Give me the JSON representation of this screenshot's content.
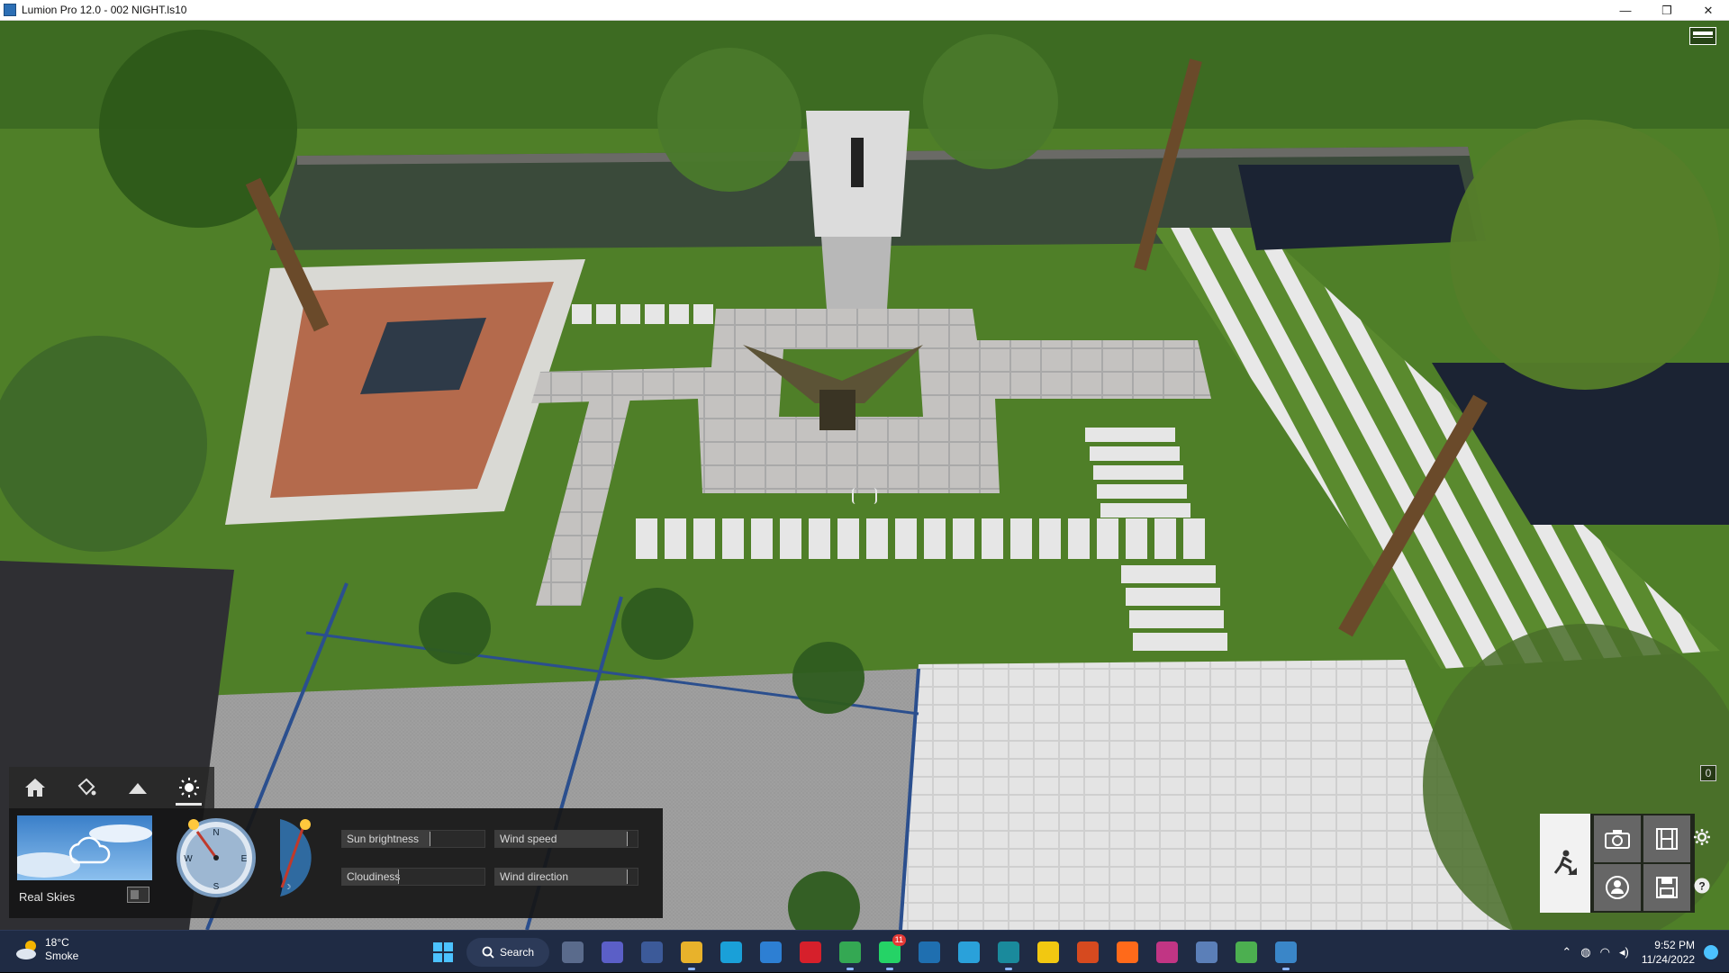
{
  "window": {
    "title": "Lumion Pro 12.0  - 002 NIGHT.ls10",
    "minimize_glyph": "—",
    "maximize_glyph": "❐",
    "close_glyph": "✕"
  },
  "viewport": {
    "corner_marker": "0"
  },
  "weather_panel": {
    "tabs": [
      {
        "icon": "house-icon",
        "active": false
      },
      {
        "icon": "paint-bucket-icon",
        "active": false
      },
      {
        "icon": "landscape-icon",
        "active": false
      },
      {
        "icon": "sun-icon",
        "active": true
      }
    ],
    "real_skies_label": "Real Skies",
    "real_skies_enabled": false,
    "compass": {
      "n": "N",
      "e": "E",
      "s": "S",
      "w": "W"
    },
    "sliders": {
      "sun_brightness": {
        "label": "Sun brightness",
        "value": 0.62
      },
      "wind_speed": {
        "label": "Wind speed",
        "value": 0.93
      },
      "cloudiness": {
        "label": "Cloudiness",
        "value": 0.4
      },
      "wind_direction": {
        "label": "Wind direction",
        "value": 0.93
      }
    }
  },
  "tool_panel": {
    "tools": [
      "build-mode-icon",
      "camera-icon",
      "film-icon",
      "panorama-icon",
      "save-icon"
    ],
    "side_icons": [
      "settings-icon",
      "help-icon"
    ]
  },
  "taskbar": {
    "weather": {
      "temp": "18°C",
      "condition": "Smoke"
    },
    "search_label": "Search",
    "whatsapp_badge": "11",
    "clock": {
      "time": "9:52 PM",
      "date": "11/24/2022"
    },
    "apps": [
      {
        "name": "task-view-icon",
        "color": "#5a6b8c"
      },
      {
        "name": "teams-icon",
        "color": "#5b5fc7"
      },
      {
        "name": "calculator-icon",
        "color": "#3c5a99"
      },
      {
        "name": "file-explorer-icon",
        "color": "#e8b22b"
      },
      {
        "name": "edge-icon",
        "color": "#1aa0d8"
      },
      {
        "name": "store-icon",
        "color": "#2d7fd3"
      },
      {
        "name": "opera-icon",
        "color": "#d6202b"
      },
      {
        "name": "chrome-icon",
        "color": "#34a853"
      },
      {
        "name": "whatsapp-icon",
        "color": "#25d366"
      },
      {
        "name": "shield-app-icon",
        "color": "#1f6fb0"
      },
      {
        "name": "telegram-icon",
        "color": "#2aa1da"
      },
      {
        "name": "sketchup-icon",
        "color": "#1a8a9c"
      },
      {
        "name": "sticky-notes-icon",
        "color": "#f2c811"
      },
      {
        "name": "grammarly-icon",
        "color": "#d64a1f"
      },
      {
        "name": "soundcloud-icon",
        "color": "#ff6a1a"
      },
      {
        "name": "instagram-icon",
        "color": "#c13584"
      },
      {
        "name": "chart-app-icon",
        "color": "#5b7fb8"
      },
      {
        "name": "v-app-icon",
        "color": "#4caf50"
      },
      {
        "name": "lumion-icon",
        "color": "#3a86c8"
      }
    ]
  }
}
